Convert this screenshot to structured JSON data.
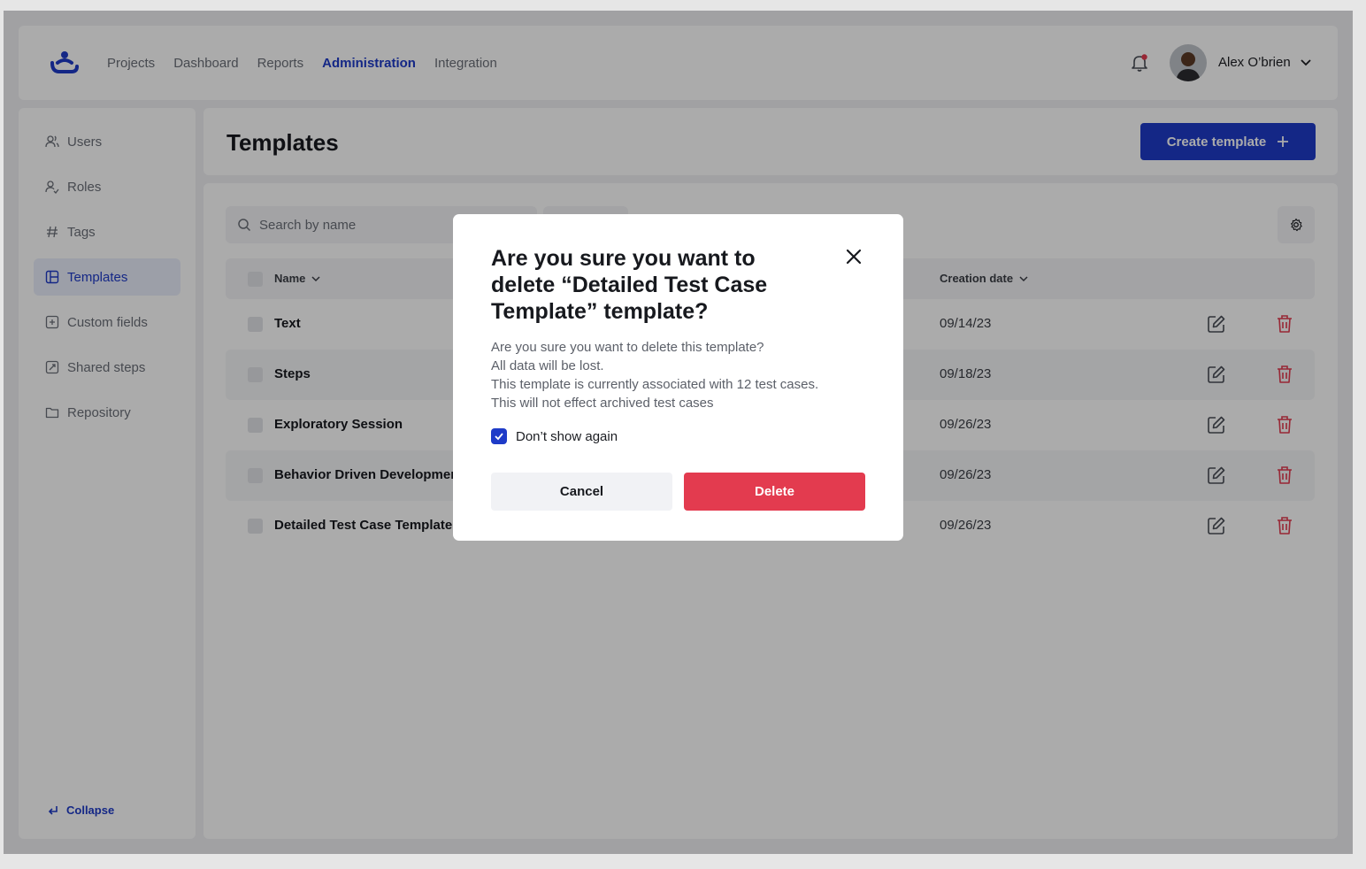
{
  "topbar": {
    "nav": [
      {
        "label": "Projects",
        "active": false
      },
      {
        "label": "Dashboard",
        "active": false
      },
      {
        "label": "Reports",
        "active": false
      },
      {
        "label": "Administration",
        "active": true
      },
      {
        "label": "Integration",
        "active": false
      }
    ],
    "user_name": "Alex O’brien",
    "notification_dot_color": "#e33b4f"
  },
  "sidebar": {
    "items": [
      {
        "label": "Users",
        "icon": "users-icon"
      },
      {
        "label": "Roles",
        "icon": "roles-icon"
      },
      {
        "label": "Tags",
        "icon": "hash-icon"
      },
      {
        "label": "Templates",
        "icon": "template-icon",
        "active": true
      },
      {
        "label": "Custom fields",
        "icon": "plus-square-icon"
      },
      {
        "label": "Shared steps",
        "icon": "shared-steps-icon"
      },
      {
        "label": "Repository",
        "icon": "folder-icon"
      }
    ],
    "collapse_label": "Collapse"
  },
  "page": {
    "title": "Templates",
    "create_button_label": "Create template"
  },
  "search": {
    "placeholder": "Search by name"
  },
  "table": {
    "columns": {
      "name": "Name",
      "date": "Creation date"
    },
    "rows": [
      {
        "name": "Text",
        "date": "09/14/23"
      },
      {
        "name": "Steps",
        "date": "09/18/23"
      },
      {
        "name": "Exploratory Session",
        "date": "09/26/23"
      },
      {
        "name": "Behavior Driven Development",
        "date": "09/26/23"
      },
      {
        "name": "Detailed Test  Case Template",
        "date": "09/26/23"
      }
    ]
  },
  "modal": {
    "title": "Are you sure you want to delete “Detailed Test Case Template” template?",
    "body": [
      "Are you sure you want to delete this template?",
      "All data will be lost.",
      "This template is currently associated with 12 test cases.",
      "This will not effect archived test cases"
    ],
    "checkbox_label": "Don’t show again",
    "checkbox_checked": true,
    "cancel_label": "Cancel",
    "delete_label": "Delete"
  },
  "colors": {
    "accent": "#1e3bc8",
    "danger": "#e33b4f"
  }
}
